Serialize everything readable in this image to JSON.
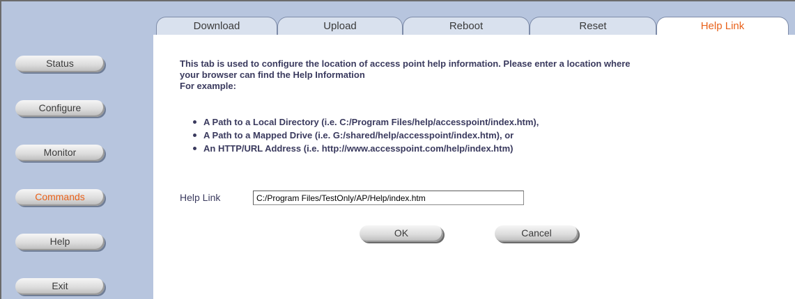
{
  "sidebar": {
    "items": [
      {
        "label": "Status",
        "active": false
      },
      {
        "label": "Configure",
        "active": false
      },
      {
        "label": "Monitor",
        "active": false
      },
      {
        "label": "Commands",
        "active": true
      },
      {
        "label": "Help",
        "active": false
      },
      {
        "label": "Exit",
        "active": false
      }
    ]
  },
  "tabs": [
    {
      "label": "Download",
      "active": false
    },
    {
      "label": "Upload",
      "active": false
    },
    {
      "label": "Reboot",
      "active": false
    },
    {
      "label": "Reset",
      "active": false
    },
    {
      "label": "Help Link",
      "active": true
    }
  ],
  "main": {
    "description_line1": "This tab is used to configure the location of access point help information. Please enter a location where",
    "description_line2": "your browser can find the Help Information",
    "description_line3": "For example:",
    "examples": [
      "A Path to a Local Directory (i.e. C:/Program Files/help/accesspoint/index.htm),",
      "A Path to a Mapped Drive (i.e. G:/shared/help/accesspoint/index.htm), or",
      "An HTTP/URL Address (i.e. http://www.accesspoint.com/help/index.htm)"
    ],
    "help_link_label": "Help Link",
    "help_link_value": "C:/Program Files/TestOnly/AP/Help/index.htm",
    "ok_label": "OK",
    "cancel_label": "Cancel"
  },
  "colors": {
    "sidebar_bg": "#b7c5de",
    "active_text": "#e8611a",
    "body_text": "#3a3a5e"
  }
}
